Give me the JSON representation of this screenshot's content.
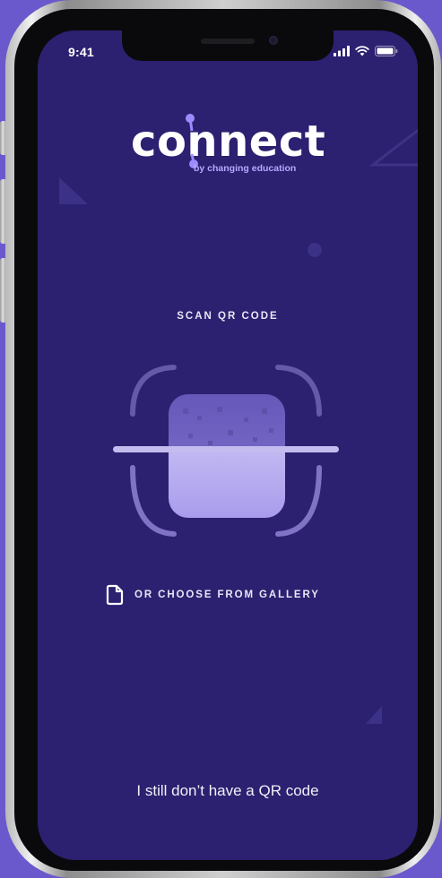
{
  "status_bar": {
    "time": "9:41",
    "icons": [
      "signal-icon",
      "wifi-icon",
      "battery-icon"
    ]
  },
  "logo": {
    "wordmark": "connect",
    "tagline": "by changing education",
    "accent_color": "#9c8bff"
  },
  "scan": {
    "title": "SCAN QR CODE",
    "icon": "qr-scan-icon"
  },
  "gallery": {
    "label": "OR CHOOSE FROM GALLERY",
    "icon": "file-icon"
  },
  "footer": {
    "no_qr_label": "I still don’t have a QR code"
  },
  "colors": {
    "background": "#6a59cc",
    "screen": "#2c2070",
    "text": "#ffffff"
  }
}
